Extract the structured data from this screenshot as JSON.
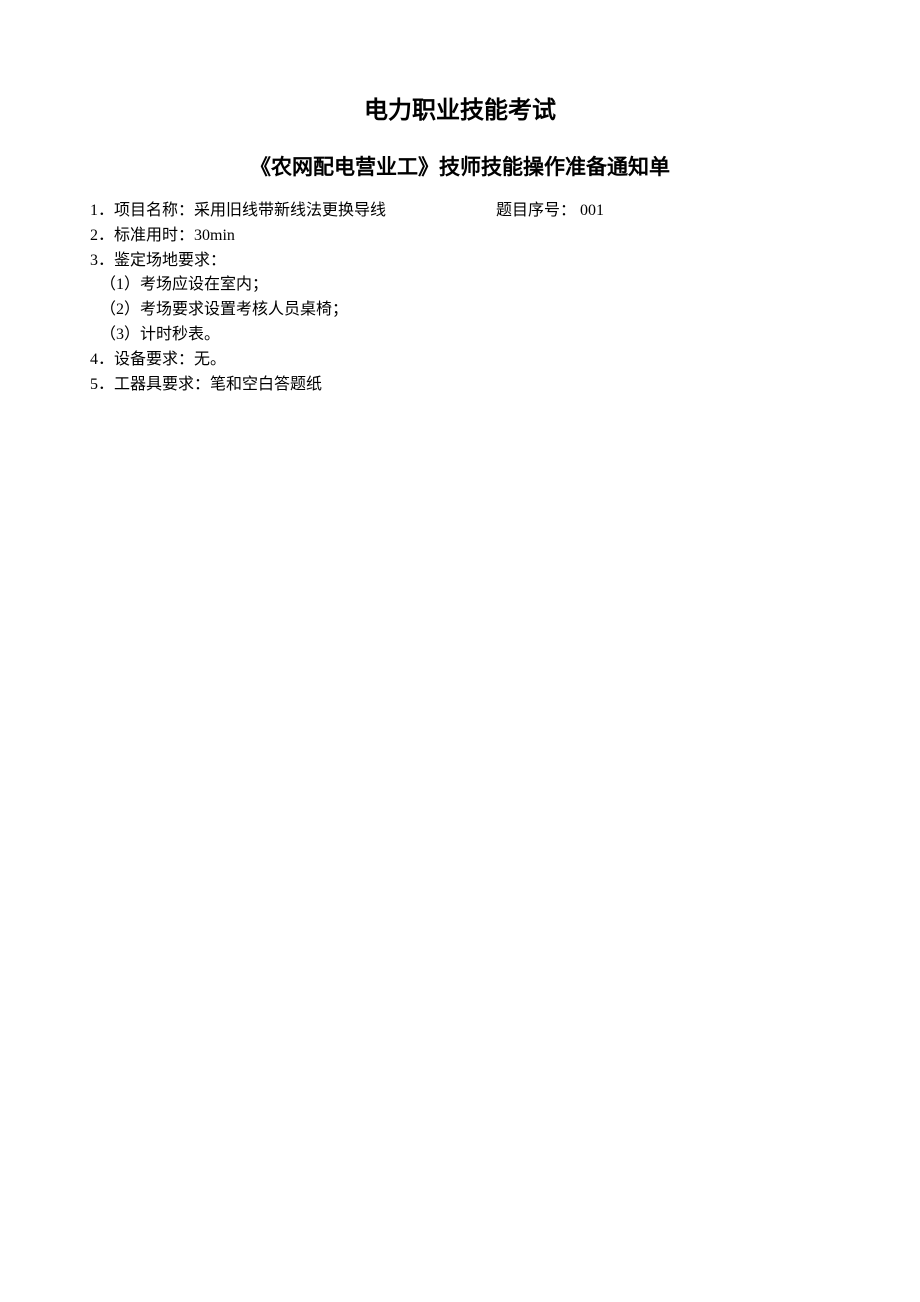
{
  "title_main": "电力职业技能考试",
  "title_sub": "《农网配电营业工》技师技能操作准备通知单",
  "item1_label": "1．项目名称：",
  "item1_value": "采用旧线带新线法更换导线",
  "item1_question_label": "题目序号：",
  "item1_question_no": " 001",
  "item2": "2．标准用时：30min",
  "item3": "3．鉴定场地要求：",
  "item3_1": "（1）考场应设在室内；",
  "item3_2": "（2）考场要求设置考核人员桌椅；",
  "item3_3": "（3）计时秒表。",
  "item4": "4．设备要求：无。",
  "item5": "5．工器具要求：笔和空白答题纸"
}
